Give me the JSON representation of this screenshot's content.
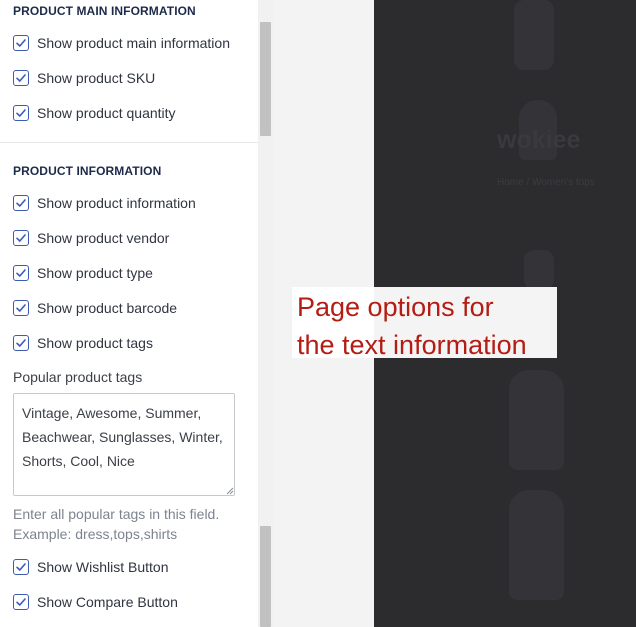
{
  "sections": {
    "main_info": {
      "title": "PRODUCT MAIN INFORMATION",
      "options": [
        {
          "label": "Show product main information",
          "checked": true
        },
        {
          "label": "Show product SKU",
          "checked": true
        },
        {
          "label": "Show product quantity",
          "checked": true
        }
      ]
    },
    "product_info": {
      "title": "PRODUCT INFORMATION",
      "options": [
        {
          "label": "Show product information",
          "checked": true
        },
        {
          "label": "Show product vendor",
          "checked": true
        },
        {
          "label": "Show product type",
          "checked": true
        },
        {
          "label": "Show product barcode",
          "checked": true
        },
        {
          "label": "Show product tags",
          "checked": true
        }
      ],
      "popular_tags": {
        "label": "Popular product tags",
        "value": "Vintage, Awesome, Summer, Beachwear, Sunglasses, Winter, Shorts, Cool, Nice",
        "help": "Enter all popular tags in this field. Example: dress,tops,shirts"
      }
    },
    "buttons": {
      "options": [
        {
          "label": "Show Wishlist Button",
          "checked": true
        },
        {
          "label": "Show Compare Button",
          "checked": true
        }
      ]
    }
  },
  "callout": {
    "line1": "Page options for",
    "line2": "the text information"
  },
  "preview": {
    "brand": "wokiee",
    "breadcrumb": "Home  /  Women's tops"
  },
  "colors": {
    "accent": "#3b5bb5",
    "callout_text": "#b31d14",
    "preview_bg": "#2c2c2e"
  }
}
